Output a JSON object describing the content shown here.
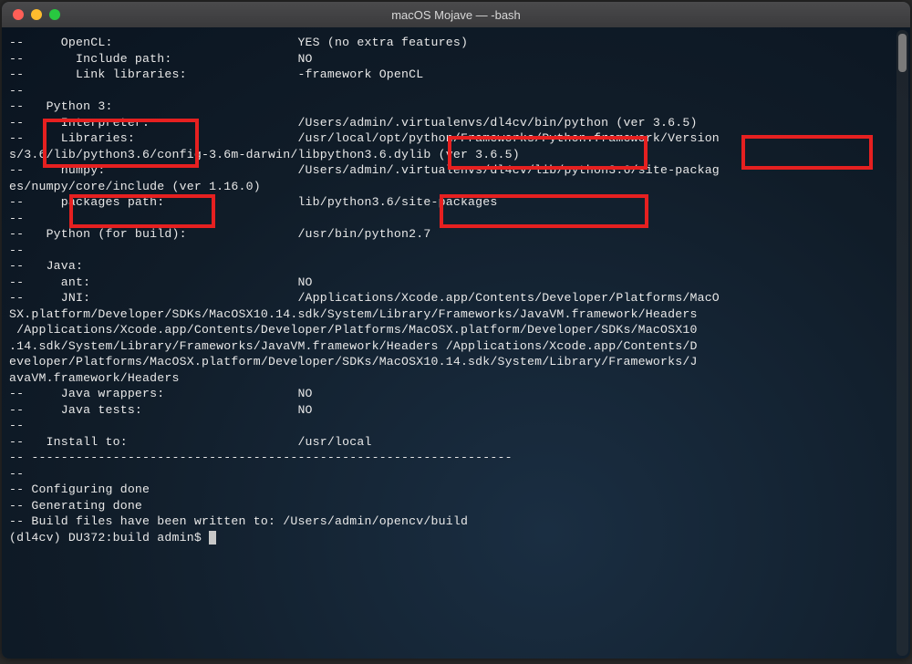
{
  "window": {
    "title": "macOS Mojave — -bash"
  },
  "lines": {
    "l1": "--     OpenCL:                         YES (no extra features)",
    "l2": "--       Include path:                 NO",
    "l3": "--       Link libraries:               -framework OpenCL",
    "l4": "--",
    "l5": "--   Python 3:",
    "l6": "--     Interpreter:                    /Users/admin/.virtualenvs/dl4cv/bin/python (ver 3.6.5)",
    "l7": "--     Libraries:                      /usr/local/opt/python/Frameworks/Python.framework/Version",
    "l8": "s/3.6/lib/python3.6/config-3.6m-darwin/libpython3.6.dylib (ver 3.6.5)",
    "l9": "--     numpy:                          /Users/admin/.virtualenvs/dl4cv/lib/python3.6/site-packag",
    "l10": "es/numpy/core/include (ver 1.16.0)",
    "l11": "--     packages path:                  lib/python3.6/site-packages",
    "l12": "--",
    "l13": "--   Python (for build):               /usr/bin/python2.7",
    "l14": "--",
    "l15": "--   Java:",
    "l16": "--     ant:                            NO",
    "l17": "--     JNI:                            /Applications/Xcode.app/Contents/Developer/Platforms/MacO",
    "l18": "SX.platform/Developer/SDKs/MacOSX10.14.sdk/System/Library/Frameworks/JavaVM.framework/Headers",
    "l19": " /Applications/Xcode.app/Contents/Developer/Platforms/MacOSX.platform/Developer/SDKs/MacOSX10",
    "l20": ".14.sdk/System/Library/Frameworks/JavaVM.framework/Headers /Applications/Xcode.app/Contents/D",
    "l21": "eveloper/Platforms/MacOSX.platform/Developer/SDKs/MacOSX10.14.sdk/System/Library/Frameworks/J",
    "l22": "avaVM.framework/Headers",
    "l23": "--     Java wrappers:                  NO",
    "l24": "--     Java tests:                     NO",
    "l25": "--",
    "l26": "--   Install to:                       /usr/local",
    "l27": "-- -----------------------------------------------------------------",
    "l28": "--",
    "l29": "-- Configuring done",
    "l30": "-- Generating done",
    "l31": "-- Build files have been written to: /Users/admin/opencv/build",
    "prompt": "(dl4cv) DU372:build admin$ "
  },
  "highlights": {
    "python3_interpreter": "Python 3 / Interpreter section",
    "virtualenv1": ".virtualenvs/dl4cv/",
    "ver365": "(ver 3.6.5)",
    "numpy": "numpy:",
    "virtualenv2": "/.virtualenvs/dl4cv/"
  }
}
